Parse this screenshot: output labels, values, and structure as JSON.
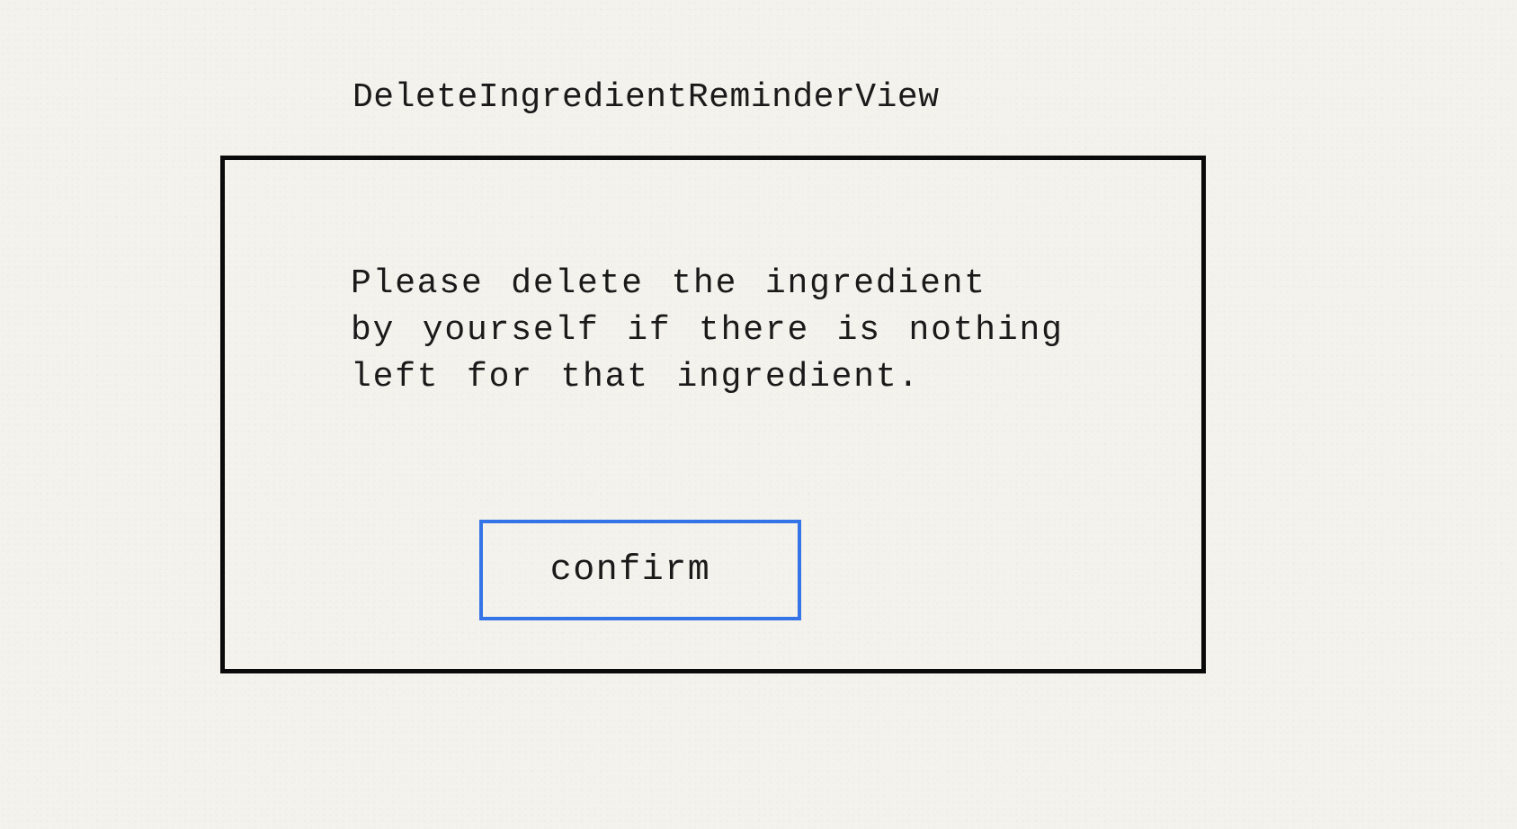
{
  "view": {
    "title": "DeleteIngredientReminderView"
  },
  "dialog": {
    "message_lines": [
      "Please delete the ingredient",
      "by yourself if there is nothing",
      "left for that ingredient."
    ],
    "confirm_label": "confirm"
  },
  "colors": {
    "background": "#f4f2ec",
    "frame_border": "#0a0a0a",
    "button_border": "#3574e6",
    "text": "#1a1a1a"
  }
}
